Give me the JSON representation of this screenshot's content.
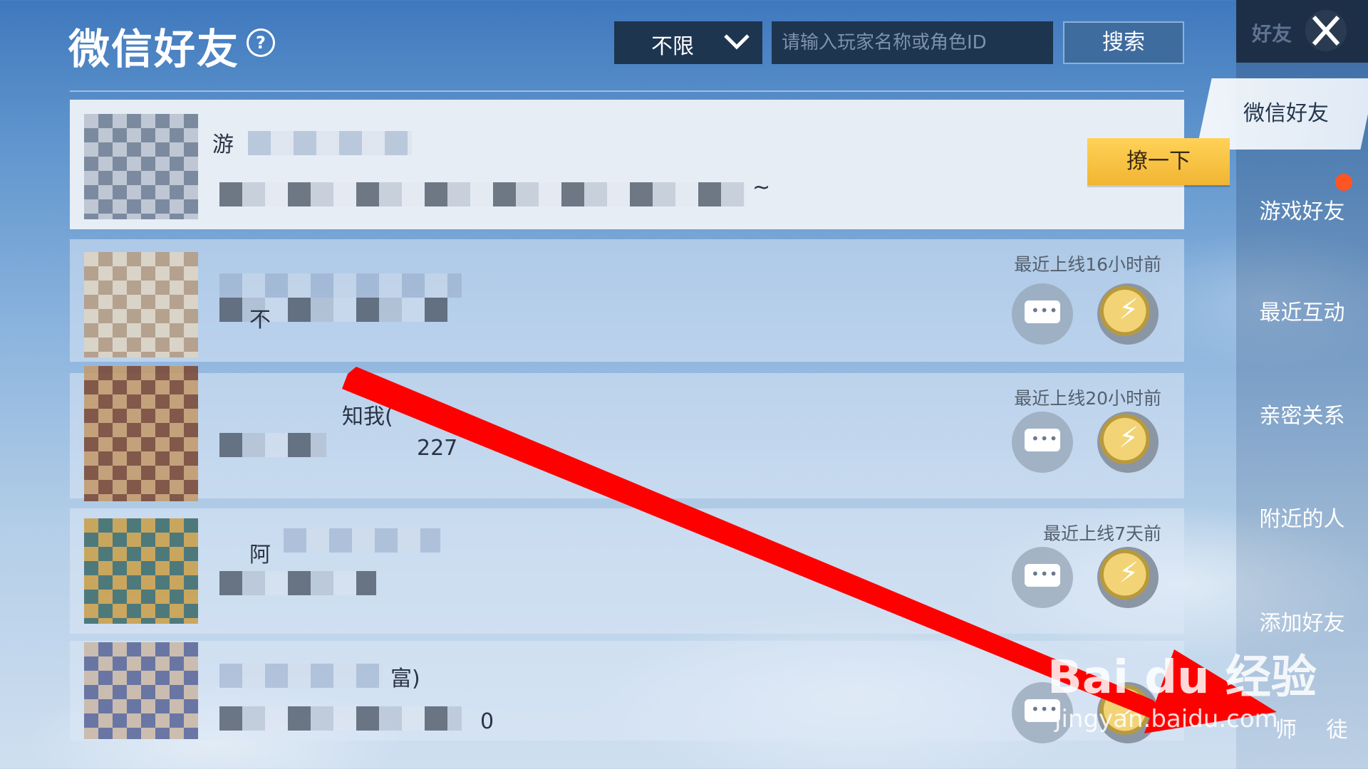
{
  "header": {
    "title": "微信好友",
    "filter_value": "不限",
    "search_placeholder": "请输入玩家名称或角色ID",
    "search_label": "搜索"
  },
  "sidebar": {
    "header_label": "好友",
    "items": [
      {
        "label": "微信好友"
      },
      {
        "label": "游戏好友"
      },
      {
        "label": "最近互动"
      },
      {
        "label": "亲密关系"
      },
      {
        "label": "附近的人"
      },
      {
        "label": "添加好友"
      },
      {
        "label": "师 徒"
      }
    ]
  },
  "friends": [
    {
      "name": "游",
      "sub": "~",
      "action": "撩一下"
    },
    {
      "status": "最近上线16小时前",
      "sub": "不"
    },
    {
      "status": "最近上线20小时前",
      "name": "知我(",
      "sub": "227"
    },
    {
      "status": "最近上线7天前",
      "name": "阿"
    },
    {
      "name": "富)",
      "sub": "0"
    }
  ],
  "watermark": {
    "text": "Bai du 经验",
    "url": "jingyan.baidu.com"
  },
  "colors": {
    "arrow": "#ff0000",
    "poke_button": "#f5c23e",
    "notification": "#ff5522"
  }
}
